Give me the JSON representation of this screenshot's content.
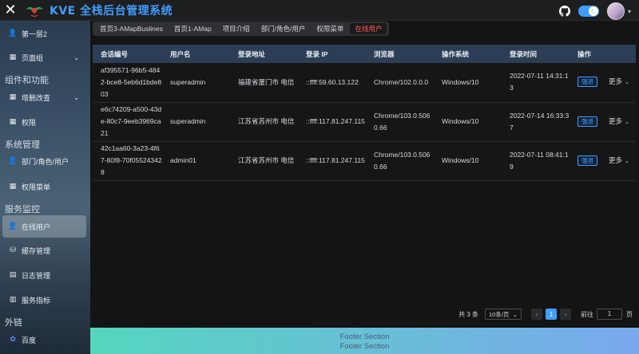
{
  "app": {
    "title": "KVE 全栈后台管理系统",
    "accent": "#409eff"
  },
  "header": {
    "close_icon": "close-icon",
    "github_icon": "github-icon",
    "theme_toggle": "moon-icon"
  },
  "sidebar": {
    "items": [
      {
        "label": "第一层2",
        "icon": "user-icon",
        "y": 6,
        "arrow": false
      },
      {
        "label": "页面组",
        "icon": "grid-icon",
        "y": 33,
        "arrow": true
      }
    ],
    "groups": [
      {
        "label": "组件和功能"
      },
      {
        "label": "系统管理"
      },
      {
        "label": "服务监控"
      },
      {
        "label": "外链"
      }
    ],
    "feature_items": [
      {
        "label": "增删改查",
        "icon": "grid-icon"
      },
      {
        "label": "权限",
        "icon": "grid-icon"
      }
    ],
    "system_items": [
      {
        "label": "部门/角色/用户",
        "icon": "user-icon"
      },
      {
        "label": "权限菜单",
        "icon": "grid-icon"
      }
    ],
    "monitor_items": [
      {
        "label": "在线用户",
        "icon": "user-icon"
      },
      {
        "label": "缓存管理",
        "icon": "database-icon"
      },
      {
        "label": "日志管理",
        "icon": "calendar-icon"
      },
      {
        "label": "服务指标",
        "icon": "chart-icon"
      }
    ],
    "link_items": [
      {
        "label": "百度",
        "icon": "baidu-icon"
      }
    ]
  },
  "tabs": [
    {
      "label": "首页3-AMapBuslines"
    },
    {
      "label": "首页1-AMap"
    },
    {
      "label": "项目介绍"
    },
    {
      "label": "部门/角色/用户"
    },
    {
      "label": "权限菜单"
    },
    {
      "label": "在线用户"
    }
  ],
  "table": {
    "headers": [
      "会话编号",
      "用户名",
      "登录地址",
      "登录 IP",
      "浏览器",
      "操作系统",
      "登录时间",
      "操作"
    ],
    "rows": [
      {
        "session": "af395571-96b5-4842-bce8-5eb6d1bde803",
        "user": "superadmin",
        "addr": "福建省厦门市 电信",
        "ip": "::ffff:59.60.13.122",
        "browser": "Chrome/102.0.0.0",
        "os": "Windows/10",
        "time": "2022-07-11 14:31:13"
      },
      {
        "session": "e6c74209-a500-43de-80c7-9eeb3969ca21",
        "user": "superadmin",
        "addr": "江苏省苏州市 电信",
        "ip": "::ffff:117.81.247.115",
        "browser": "Chrome/103.0.5060.66",
        "os": "Windows/10",
        "time": "2022-07-14 16:33:37"
      },
      {
        "session": "42c1aa60-3a23-4f67-80f8-70f055243428",
        "user": "admin01",
        "addr": "江苏省苏州市 电信",
        "ip": "::ffff:117.81.247.115",
        "browser": "Chrome/103.0.5060.66",
        "os": "Windows/10",
        "time": "2022-07-11 08:41:19"
      }
    ],
    "action_force": "强退",
    "action_more": "更多"
  },
  "pagination": {
    "total": "共 3 条",
    "page_size": "10条/页",
    "current": "1",
    "goto_label": "前往",
    "goto_value": "1",
    "goto_unit": "页"
  },
  "footer": {
    "line1": "Footer Section",
    "line2": "Footer Section"
  }
}
